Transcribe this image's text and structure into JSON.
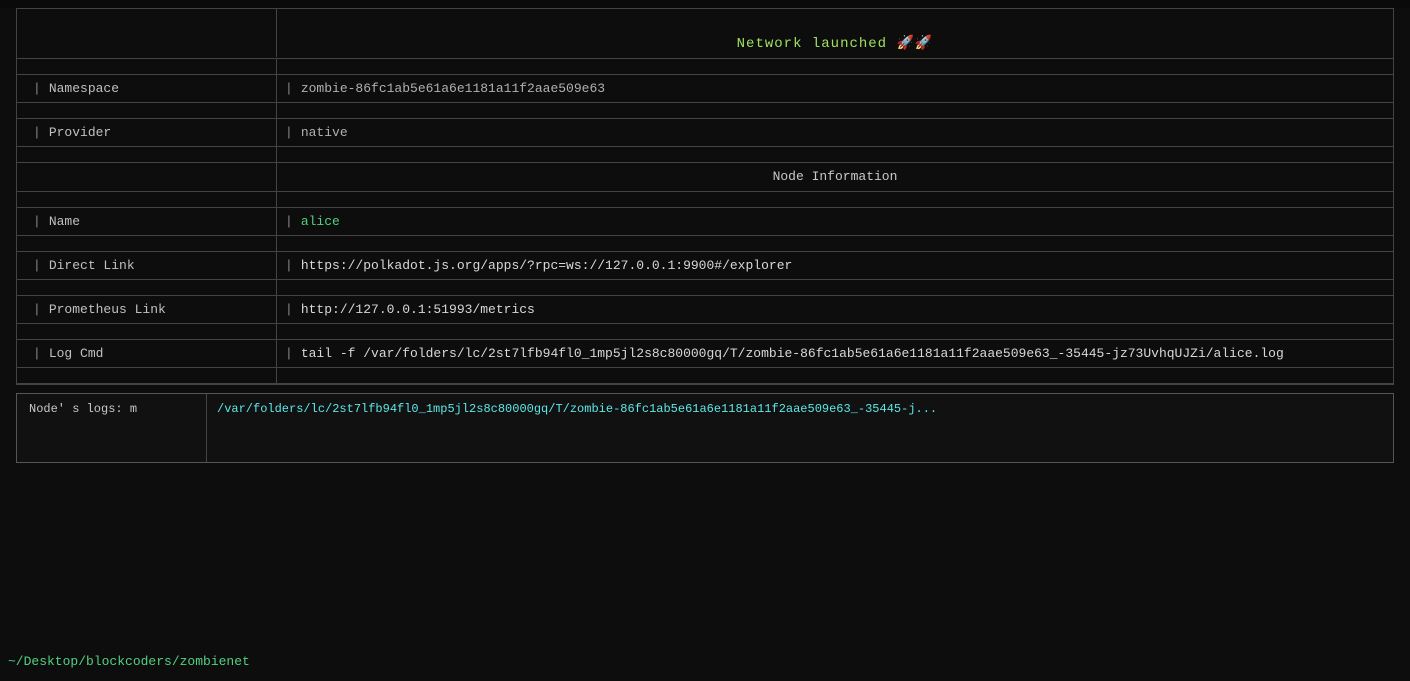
{
  "header": {
    "network_launched": "Network launched 🚀🚀"
  },
  "info_rows": {
    "namespace_label": "Namespace",
    "namespace_value": "zombie-86fc1ab5e61a6e1181a11f2aae509e63",
    "provider_label": "Provider",
    "provider_value": "native",
    "node_info_header": "Node Information",
    "name_label": "Name",
    "name_value": "alice",
    "direct_link_label": "Direct Link",
    "direct_link_value": "https://polkadot.js.org/apps/?rpc=ws://127.0.0.1:9900#/explorer",
    "prometheus_link_label": "Prometheus Link",
    "prometheus_link_value": "http://127.0.0.1:51993/metrics",
    "log_cmd_label": "Log Cmd",
    "log_cmd_value": "tail -f  /var/folders/lc/2st7lfb94fl0_1mp5jl2s8c80000gq/T/zombie-86fc1ab5e61a6e1181a11f2aae509e63_-35445-jz73UvhqUJZi/alice.log"
  },
  "logs": {
    "label": "Node'\ns logs:\nm",
    "content": "/var/folders/lc/2st7lfb94fl0_1mp5jl2s8c80000gq/T/zombie-86fc1ab5e61a6e1181a11f2aae509e63_-35445-j..."
  },
  "footer": {
    "path": "~/Desktop/blockcoders/zombienet"
  }
}
